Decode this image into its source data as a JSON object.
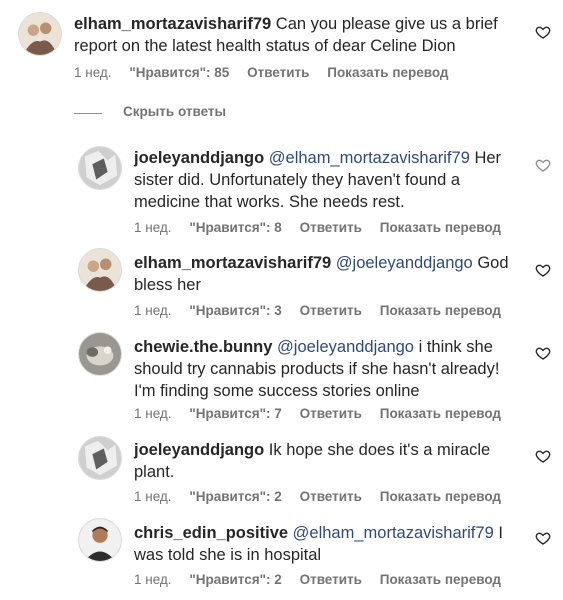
{
  "meta_labels": {
    "reply": "Ответить",
    "translate": "Показать перевод"
  },
  "hide_replies": "Скрыть ответы",
  "comments": [
    {
      "user": "elham_mortazavisharif79",
      "mention": "",
      "text": "Can you please give us a brief report on the latest health status of dear Celine Dion",
      "time": "1 нед.",
      "likes": "\"Нравится\": 85"
    },
    {
      "user": "joeleyanddjango",
      "mention": "@elham_mortazavisharif79",
      "text": "Her sister did. Unfortunately they haven't found a medicine that works. She needs rest.",
      "time": "1 нед.",
      "likes": "\"Нравится\": 8"
    },
    {
      "user": "elham_mortazavisharif79",
      "mention": "@joeleyanddjango",
      "text": "God bless her",
      "time": "1 нед.",
      "likes": "\"Нравится\": 3"
    },
    {
      "user": "chewie.the.bunny",
      "mention": "@joeleyanddjango",
      "text": "i think she should try cannabis products if she hasn't already! I'm finding some success stories online",
      "time": "1 нед.",
      "likes": "\"Нравится\": 7"
    },
    {
      "user": "joeleyanddjango",
      "mention": "",
      "text": "Ik hope she does it's a miracle plant.",
      "time": "1 нед.",
      "likes": "\"Нравится\": 2"
    },
    {
      "user": "chris_edin_positive",
      "mention": "@elham_mortazavisharif79",
      "text": "I was told she is in hospital",
      "time": "1 нед.",
      "likes": "\"Нравится\": 2"
    }
  ]
}
